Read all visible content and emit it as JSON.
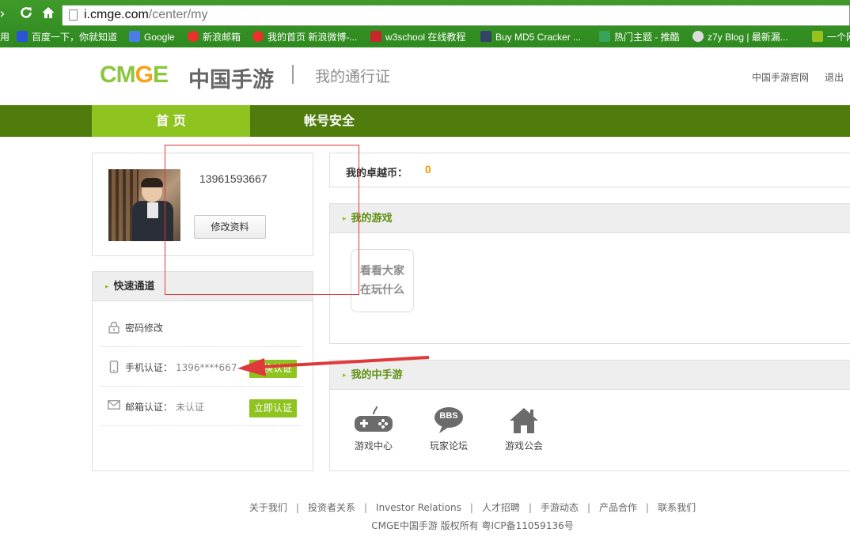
{
  "browser": {
    "url_host": "i.cmge.com",
    "url_path": "/center/my",
    "bookmarks": [
      {
        "label": "用",
        "color": "#2e8a1f"
      },
      {
        "label": "百度一下，你就知道",
        "color": "#2a55d6"
      },
      {
        "label": "Google",
        "color": "#4a7de8"
      },
      {
        "label": "新浪邮箱",
        "color": "#e8322a"
      },
      {
        "label": "我的首页 新浪微博-...",
        "color": "#e8322a"
      },
      {
        "label": "w3school 在线教程",
        "color": "#c7282b"
      },
      {
        "label": "Buy MD5 Cracker ...",
        "color": "#334466"
      },
      {
        "label": "热门主题 - 推酷",
        "color": "#3aa35a"
      },
      {
        "label": "z7y Blog | 最新漏...",
        "color": "#dcdcdc"
      },
      {
        "label": "一个网",
        "color": "#96c11f"
      }
    ]
  },
  "header": {
    "logo_text": "CMGE",
    "logo_cn": "中国手游",
    "subtitle": "我的通行证",
    "link_official": "中国手游官网",
    "link_logout": "退出"
  },
  "nav": {
    "tabs": [
      {
        "label": "首 页",
        "active": true
      },
      {
        "label": "帐号安全",
        "active": false
      }
    ]
  },
  "profile": {
    "username": "13961593667",
    "edit_button": "修改资料"
  },
  "quick": {
    "title": "快速通道",
    "password": {
      "label": "密码修改",
      "icon": "lock-icon"
    },
    "phone": {
      "label": "手机认证：",
      "value": "1396****667",
      "button": "更换认证",
      "icon": "mobile-icon"
    },
    "email": {
      "label": "邮箱认证：",
      "value": "未认证",
      "button": "立即认证",
      "icon": "mail-icon"
    }
  },
  "coins": {
    "label": "我的卓越币：",
    "value": "0"
  },
  "games": {
    "title": "我的游戏",
    "see_line1": "看看大家",
    "see_line2": "在玩什么"
  },
  "cmge_section": {
    "title": "我的中手游",
    "items": [
      {
        "label": "游戏中心",
        "icon": "gamepad-icon"
      },
      {
        "label": "玩家论坛",
        "icon": "bbs-icon",
        "badge": "BBS"
      },
      {
        "label": "游戏公会",
        "icon": "house-icon"
      }
    ]
  },
  "footer": {
    "links": [
      "关于我们",
      "投资者关系",
      "Investor Relations",
      "人才招聘",
      "手游动态",
      "产品合作",
      "联系我们"
    ],
    "copyright": "CMGE中国手游 版权所有 粤ICP备11059136号"
  },
  "colors": {
    "accent_green": "#8fc31f",
    "nav_green": "#4f7c0c",
    "coin_orange": "#f39800",
    "annotation_red": "#e0393c"
  }
}
